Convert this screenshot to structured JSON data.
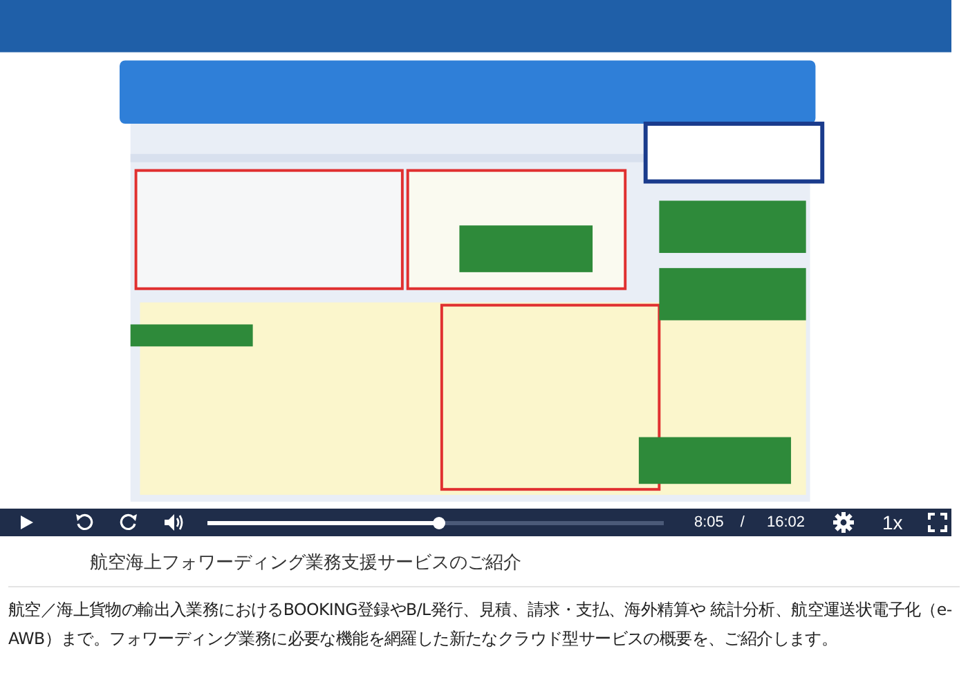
{
  "video": {
    "playing": false,
    "progress": {
      "level": 0.505
    },
    "current_time": "8:05",
    "separator": "/",
    "duration": "16:02",
    "speed": "1x"
  },
  "title": "航空海上フォワーディング業務支援サービスのご紹介",
  "description": "航空／海上貨物の輸出入業務におけるBOOKING登録やB/L発行、見積、請求・支払、海外精算や 統計分析、航空運送状電子化（e-AWB）まで。フォワーディング業務に必要な機能を網羅した新たなクラウド型サービスの概要を、ご紹介します。"
}
